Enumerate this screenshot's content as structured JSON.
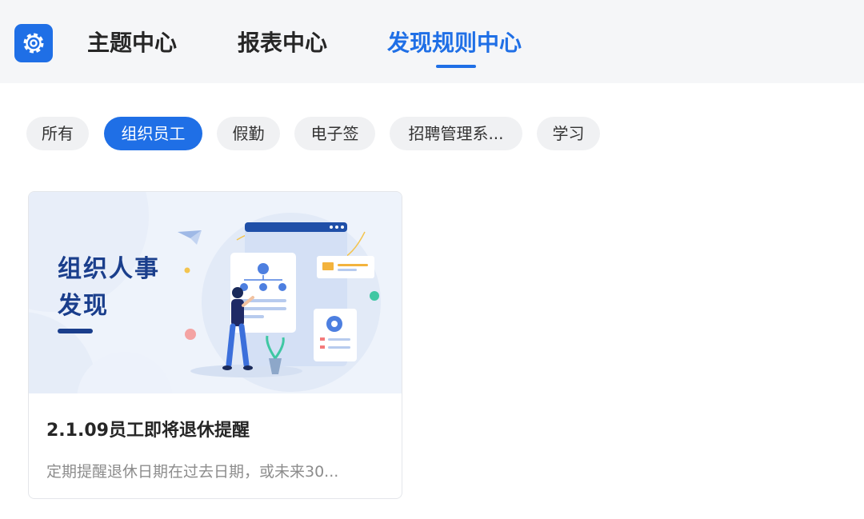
{
  "header": {
    "app_icon": "gear-icon",
    "tabs": [
      {
        "label": "主题中心",
        "active": false
      },
      {
        "label": "报表中心",
        "active": false
      },
      {
        "label": "发现规则中心",
        "active": true
      }
    ]
  },
  "filters": {
    "chips": [
      {
        "label": "所有",
        "active": false
      },
      {
        "label": "组织员工",
        "active": true
      },
      {
        "label": "假勤",
        "active": false
      },
      {
        "label": "电子签",
        "active": false
      },
      {
        "label": "招聘管理系...",
        "active": false
      },
      {
        "label": "学习",
        "active": false
      }
    ]
  },
  "cards": [
    {
      "banner_line1": "组织人事",
      "banner_line2": "发现",
      "title": "2.1.09员工即将退休提醒",
      "description": "定期提醒退休日期在过去日期，或未来30..."
    }
  ],
  "colors": {
    "accent": "#1f6fe6",
    "banner_text": "#1a3e8c",
    "header_bg": "#f5f6f8",
    "chip_bg": "#f0f1f3"
  }
}
